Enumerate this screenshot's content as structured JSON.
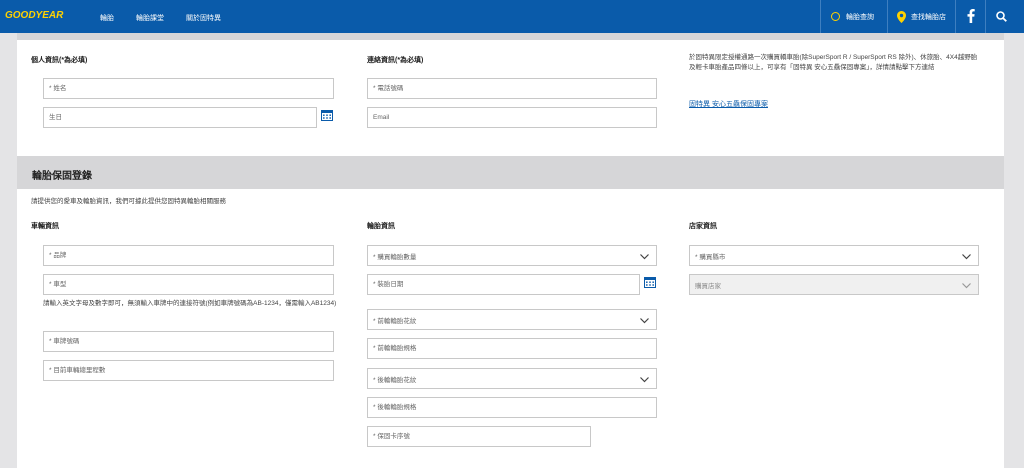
{
  "nav": {
    "logo": "GOODYEAR",
    "links": [
      "輪胎",
      "輪胎課堂",
      "關於固特異"
    ],
    "tire_search": "輪胎查詢",
    "store_search": "查找輪胎店"
  },
  "personal": {
    "heading": "個人資訊(*為必填)",
    "name_placeholder": "* 姓名",
    "birthday_placeholder": "生日"
  },
  "contact": {
    "heading": "連絡資訊(*為必填)",
    "phone_placeholder": "* 電話號碼",
    "email_placeholder": "Email"
  },
  "info": {
    "text": "於固特異限定授權通路一次購買轎車胎(除SuperSport R / SuperSport RS 除外)、休旅胎、4X4越野胎及輕卡車胎產品四條以上，可享有「固特異 安心五驫保固專案」，詳情請點擊下方連結",
    "link": "固特異 安心五驫保固專案"
  },
  "warranty": {
    "title": "輪胎保固登錄",
    "intro": "請提供您的愛車及輪胎資訊，我們可據此提供您固特異輪胎相關服務"
  },
  "vehicle": {
    "heading": "車輛資訊",
    "brand": "* 品牌",
    "model": "* 車型",
    "plate_note": "請輸入英文字母及數字即可，無須輸入車牌中的連接符號(例如車牌號碼為AB-1234，僅需輸入AB1234)",
    "plate": "* 車牌號碼",
    "mileage": "* 目前車輛總里程數"
  },
  "tire": {
    "heading": "輪胎資訊",
    "quantity": "* 購買輪胎數量",
    "install_date": "* 裝胎日期",
    "front_pattern": "* 前輪輪胎花紋",
    "front_size": "* 前輪輪胎規格",
    "rear_pattern": "* 後輪輪胎花紋",
    "rear_size": "* 後輪輪胎規格",
    "warranty_card": "* 保固卡序號"
  },
  "dealer": {
    "heading": "店家資訊",
    "city": "* 購買縣市",
    "store": "購買店家"
  },
  "colors": {
    "nav_blue": "#0a5baa",
    "logo_yellow": "#ffd200",
    "band_gray": "#d6d6d8"
  }
}
